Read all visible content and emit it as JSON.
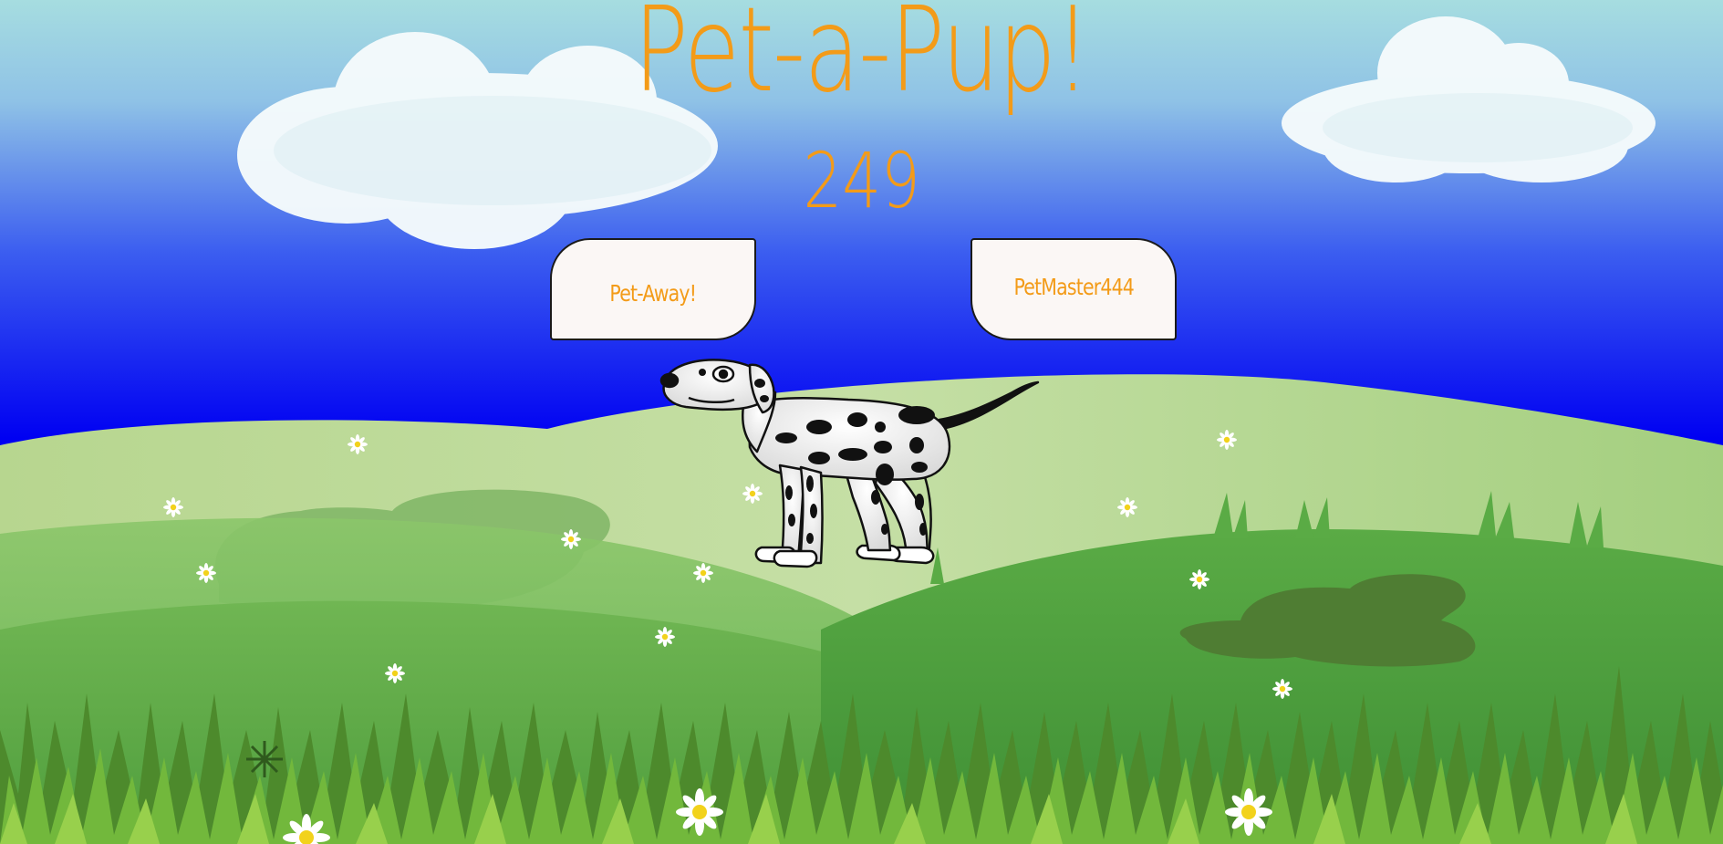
{
  "game": {
    "title": "Pet-a-Pup!",
    "score": "249"
  },
  "buttons": {
    "pet_away_label": "Pet-Away!",
    "player_label": "PetMaster444"
  },
  "colors": {
    "accent": "#f39b18",
    "sky_top": "#a6dde0",
    "sky_bottom": "#0000f2",
    "button_bg": "#fbf7f5"
  },
  "sprites": {
    "pet": "dalmatian-dog",
    "background": "grassy-hills-with-clouds-and-daisies"
  }
}
